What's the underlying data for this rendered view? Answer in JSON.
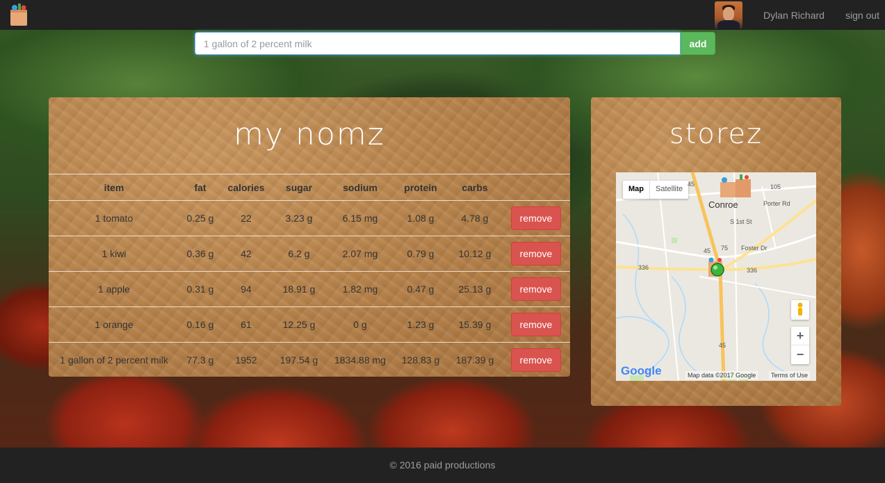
{
  "navbar": {
    "user_name": "Dylan Richard",
    "sign_out_label": "sign out"
  },
  "search": {
    "placeholder": "1 gallon of 2 percent milk",
    "add_label": "add"
  },
  "nomz": {
    "title": "my nomz",
    "columns": [
      "item",
      "fat",
      "calories",
      "sugar",
      "sodium",
      "protein",
      "carbs"
    ],
    "remove_label": "remove",
    "rows": [
      {
        "item": "1 tomato",
        "fat": "0.25 g",
        "calories": "22",
        "sugar": "3.23 g",
        "sodium": "6.15 mg",
        "protein": "1.08 g",
        "carbs": "4.78 g"
      },
      {
        "item": "1 kiwi",
        "fat": "0.36 g",
        "calories": "42",
        "sugar": "6.2 g",
        "sodium": "2.07 mg",
        "protein": "0.79 g",
        "carbs": "10.12 g"
      },
      {
        "item": "1 apple",
        "fat": "0.31 g",
        "calories": "94",
        "sugar": "18.91 g",
        "sodium": "1.82 mg",
        "protein": "0.47 g",
        "carbs": "25.13 g"
      },
      {
        "item": "1 orange",
        "fat": "0.16 g",
        "calories": "61",
        "sugar": "12.25 g",
        "sodium": "0 g",
        "protein": "1.23 g",
        "carbs": "15.39 g"
      },
      {
        "item": "1 gallon of 2 percent milk",
        "fat": "77.3 g",
        "calories": "1952",
        "sugar": "197.54 g",
        "sodium": "1834.88 mg",
        "protein": "128.83 g",
        "carbs": "187.39 g"
      }
    ]
  },
  "storez": {
    "title": "storez",
    "map": {
      "type_map": "Map",
      "type_satellite": "Satellite",
      "town": "Conroe",
      "road_labels": [
        "105",
        "75",
        "336",
        "336",
        "45",
        "45",
        "45",
        "Foster Dr",
        "Porter Rd",
        "S 1st St"
      ],
      "zoom_in": "+",
      "zoom_out": "−",
      "google": "Google",
      "attribution": "Map data ©2017 Google",
      "terms": "Terms of Use"
    }
  },
  "footer": {
    "text": "© 2016 paid productions"
  },
  "colors": {
    "navbar": "#222222",
    "add_button": "#5cb85c",
    "remove_button": "#d9534f",
    "paper": "#b7834b"
  }
}
